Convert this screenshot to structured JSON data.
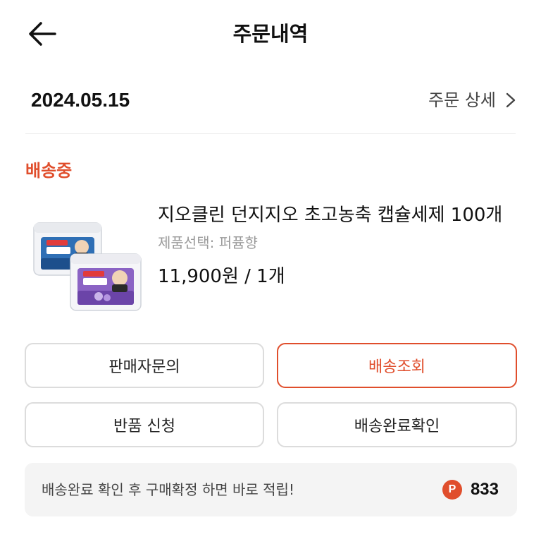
{
  "header": {
    "title": "주문내역",
    "back_icon": "arrow-left-icon"
  },
  "order": {
    "date": "2024.05.15",
    "detail_label": "주문 상세",
    "detail_icon": "chevron-right-icon"
  },
  "status": {
    "label": "배송중",
    "color": "#e04e2c"
  },
  "product": {
    "name": "지오클린 던지지오 초고농축 캡슐세제 100개",
    "option": "제품선택: 퍼퓸향",
    "price": "11,900원 / 1개"
  },
  "buttons": {
    "seller_inquiry": "판매자문의",
    "track_delivery": "배송조회",
    "return_request": "반품 신청",
    "confirm_delivery": "배송완료확인"
  },
  "notice": {
    "text": "배송완료 확인 후 구매확정 하면 바로 적립!",
    "point_icon_letter": "P",
    "point_icon_color": "#e04e2c",
    "points": "833"
  },
  "colors": {
    "accent": "#e04e2c"
  }
}
